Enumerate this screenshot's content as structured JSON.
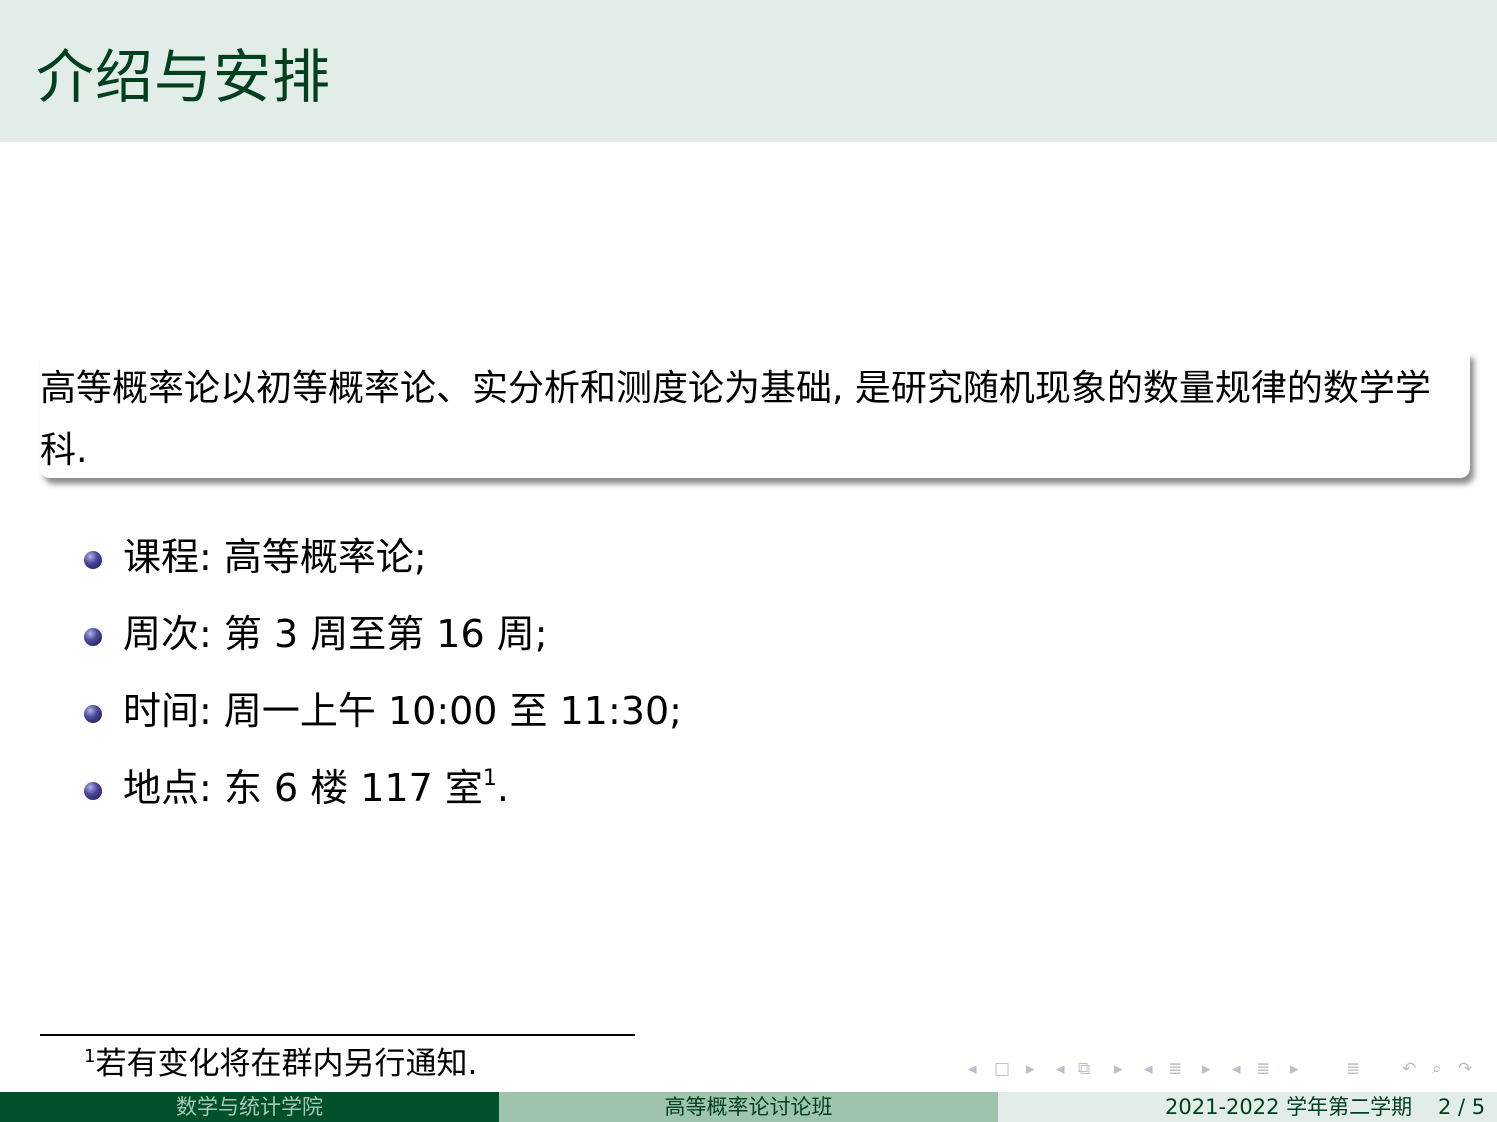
{
  "slide": {
    "title": "介绍与安排",
    "block_text": "高等概率论以初等概率论、实分析和测度论为基础, 是研究随机现象的数量规律的数学学科.",
    "items": [
      {
        "text": "课程: 高等概率论;"
      },
      {
        "text": "周次: 第 3 周至第 16 周;"
      },
      {
        "text": "时间: 周一上午 10:00 至 11:30;"
      },
      {
        "text": "地点: 东 6 楼 117 室",
        "footnote_mark": "1",
        "trailing": "."
      }
    ],
    "footnote": {
      "mark": "1",
      "text": "若有变化将在群内另行通知."
    }
  },
  "navigation": {
    "icons": [
      "left-arrow-icon",
      "frame-icon",
      "right-arrow-icon",
      "left-arrow-icon",
      "subsection-icon",
      "right-arrow-icon",
      "left-arrow-icon",
      "section-icon",
      "right-arrow-icon",
      "left-arrow-icon",
      "presentation-icon",
      "right-arrow-icon",
      "toc-icon",
      "back-icon",
      "search-icon",
      "forward-icon"
    ]
  },
  "footer": {
    "institute": "数学与统计学院",
    "course": "高等概率论讨论班",
    "term": "2021-2022 学年第二学期",
    "page": "2 / 5"
  },
  "colors": {
    "title_bar": "#e3ede7",
    "title_text": "#00401f",
    "footer_dark": "#00502a",
    "footer_mid": "#9fc4ac",
    "footer_light": "#e3ede7",
    "bullet": "#2e2e7a"
  }
}
